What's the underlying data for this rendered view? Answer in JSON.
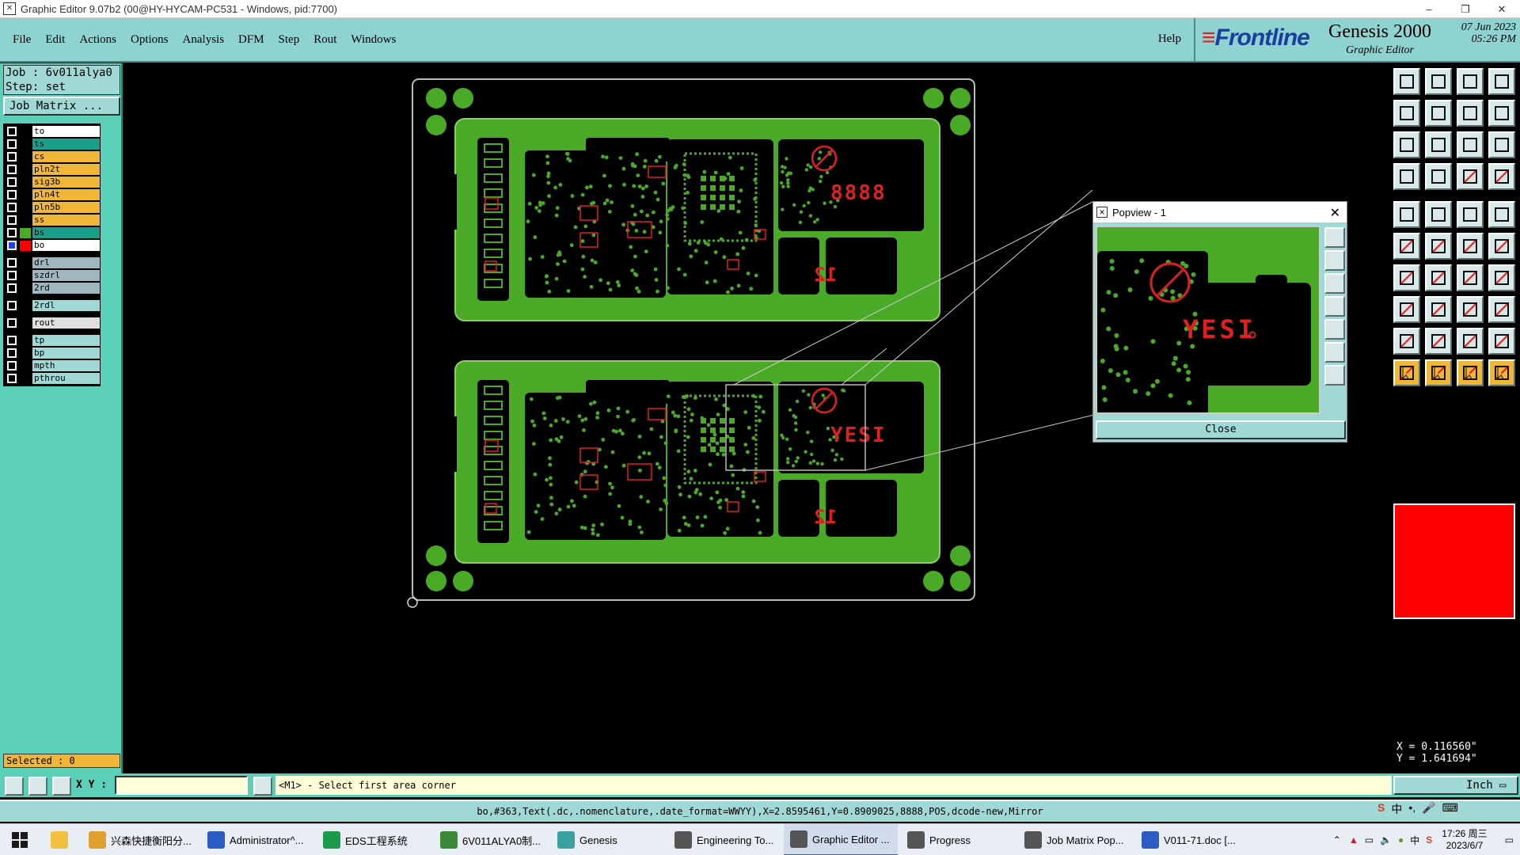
{
  "window": {
    "title": "Graphic Editor 9.07b2 (00@HY-HYCAM-PC531 - Windows, pid:7700)"
  },
  "menu": {
    "items": [
      "File",
      "Edit",
      "Actions",
      "Options",
      "Analysis",
      "DFM",
      "Step",
      "Rout",
      "Windows"
    ],
    "help": "Help"
  },
  "brand": {
    "logo": "Frontline",
    "product": "Genesis 2000",
    "subtitle": "Graphic Editor",
    "date": "07 Jun 2023",
    "time": "05:26 PM"
  },
  "job": {
    "job_label": "Job :",
    "job_name": "6v011alya0",
    "step_label": "Step:",
    "step_name": "set",
    "matrix_button": "Job Matrix ..."
  },
  "layers": [
    {
      "name": "to",
      "color": "#ffffff",
      "sw": "#000000"
    },
    {
      "name": "ts",
      "color": "#1aa08a",
      "sw": "#000000"
    },
    {
      "name": "cs",
      "color": "#f0b638",
      "sw": "#000000"
    },
    {
      "name": "pln2t",
      "color": "#f0b638",
      "sw": "#000000"
    },
    {
      "name": "sig3b",
      "color": "#f0b638",
      "sw": "#000000"
    },
    {
      "name": "pln4t",
      "color": "#f0b638",
      "sw": "#000000"
    },
    {
      "name": "pln5b",
      "color": "#f0b638",
      "sw": "#000000"
    },
    {
      "name": "ss",
      "color": "#f0b638",
      "sw": "#000000"
    },
    {
      "name": "bs",
      "color": "#1aa08a",
      "sw": "#4aaa28"
    },
    {
      "name": "bo",
      "color": "#ffffff",
      "sw": "#ff0000"
    },
    {
      "name": "drl",
      "color": "#9fb8c0",
      "sw": "#000000"
    },
    {
      "name": "szdrl",
      "color": "#9fb8c0",
      "sw": "#000000"
    },
    {
      "name": "2rd",
      "color": "#9fb8c0",
      "sw": "#000000"
    },
    {
      "name": "2rdl",
      "color": "#9fd8d4",
      "sw": "#000000"
    },
    {
      "name": "rout",
      "color": "#e0e0e0",
      "sw": "#000000"
    },
    {
      "name": "tp",
      "color": "#9fd8d4",
      "sw": "#000000"
    },
    {
      "name": "bp",
      "color": "#9fd8d4",
      "sw": "#000000"
    },
    {
      "name": "mpth",
      "color": "#9fd8d4",
      "sw": "#000000"
    },
    {
      "name": "pthrou",
      "color": "#9fd8d4",
      "sw": "#000000"
    }
  ],
  "selected": "Selected : 0",
  "board": {
    "text_top": "8888",
    "text_bottom": "YESI",
    "num_top": "12",
    "num_bottom": "12"
  },
  "popview": {
    "title": "Popview - 1",
    "close_label": "Close",
    "text": "YESI"
  },
  "coords": {
    "x": "X = 0.116560\"",
    "y": "Y = 1.641694\""
  },
  "cmd": {
    "xy_label": "X Y :",
    "prompt": "<M1> - Select first area corner",
    "unit": "Inch"
  },
  "info": "bo,#363,Text(.dc,.nomenclature,.date_format=WWYY),X=2.8595461,Y=0.8909025,8888,POS,dcode-new,Mirror",
  "taskbar": {
    "items": [
      {
        "label": "兴森快捷衡阳分...",
        "color": "#e0a030"
      },
      {
        "label": "Administrator^...",
        "color": "#2b5cc4"
      },
      {
        "label": "EDS工程系统",
        "color": "#1a9a4a"
      },
      {
        "label": "6V011ALYA0制...",
        "color": "#3a8a3a"
      },
      {
        "label": "Genesis",
        "color": "#3aa0a0"
      },
      {
        "label": "Engineering To...",
        "color": "#555555"
      },
      {
        "label": "Graphic Editor ...",
        "color": "#555555"
      },
      {
        "label": "Progress",
        "color": "#555555"
      },
      {
        "label": "Job Matrix Pop...",
        "color": "#555555"
      },
      {
        "label": "V011-71.doc [...",
        "color": "#2b5cc4"
      }
    ],
    "clock_time": "17:26 周三",
    "clock_date": "2023/6/7",
    "ime": "中"
  },
  "colors": {
    "board_green": "#4aaa28",
    "board_dark": "#1e5a12",
    "silk": "#e02020",
    "outline": "#bbbbbb"
  }
}
